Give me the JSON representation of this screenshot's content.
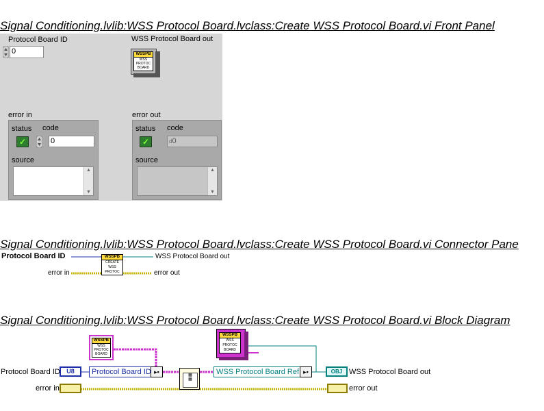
{
  "front_panel": {
    "title": "Signal Conditioning.lvlib:WSS Protocol Board.lvclass:Create WSS Protocol Board.vi Front Panel",
    "protocol_board_id": {
      "label": "Protocol Board ID",
      "value": "0"
    },
    "wss_out": {
      "label": "WSS Protocol Board out",
      "icon_header": "WSSPB",
      "icon_lines": [
        "WSS",
        "PROTOC",
        "BOARD"
      ]
    },
    "error_in": {
      "label": "error in",
      "status_label": "status",
      "code_label": "code",
      "code_value": "0",
      "source_label": "source"
    },
    "error_out": {
      "label": "error out",
      "status_label": "status",
      "code_label": "code",
      "code_prefix": "d",
      "code_value": "0",
      "source_label": "source"
    }
  },
  "connector_pane": {
    "title": "Signal Conditioning.lvlib:WSS Protocol Board.lvclass:Create WSS Protocol Board.vi Connector Pane",
    "left_top": "Protocol Board ID",
    "left_bottom": "error in",
    "right_top": "WSS Protocol Board out",
    "right_bottom": "error out",
    "icon_header": "WSSPB",
    "icon_lines": [
      "CREATE",
      "WSS",
      "PROTOC"
    ]
  },
  "block_diagram": {
    "title": "Signal Conditioning.lvlib:WSS Protocol Board.lvclass:Create WSS Protocol Board.vi Block Diagram",
    "protocol_board_id": "Protocol Board ID",
    "u8_tag": "U8",
    "error_in": "error in",
    "bundle_field_id": "Protocol Board ID",
    "bundle_field_ref": "WSS Protocol Board Ref",
    "obj_tag": "OBJ",
    "wss_out": "WSS Protocol Board out",
    "error_out": "error out",
    "const_header": "WSSPB",
    "const_lines": [
      "WSS",
      "PROTOC",
      "BOARD"
    ],
    "ref_header": "WSSPB",
    "ref_lines": [
      "WSS",
      "PROTOC",
      "BOARD"
    ]
  },
  "colors": {
    "panel_bg": "#d6d6d6",
    "cluster_bg": "#a9a9a9",
    "led_green": "#2f7d2f",
    "wire_error": "#c7b300",
    "wire_u8": "#1c2fa8",
    "wire_class": "#cc33cc",
    "wire_ref": "#007f7f"
  }
}
